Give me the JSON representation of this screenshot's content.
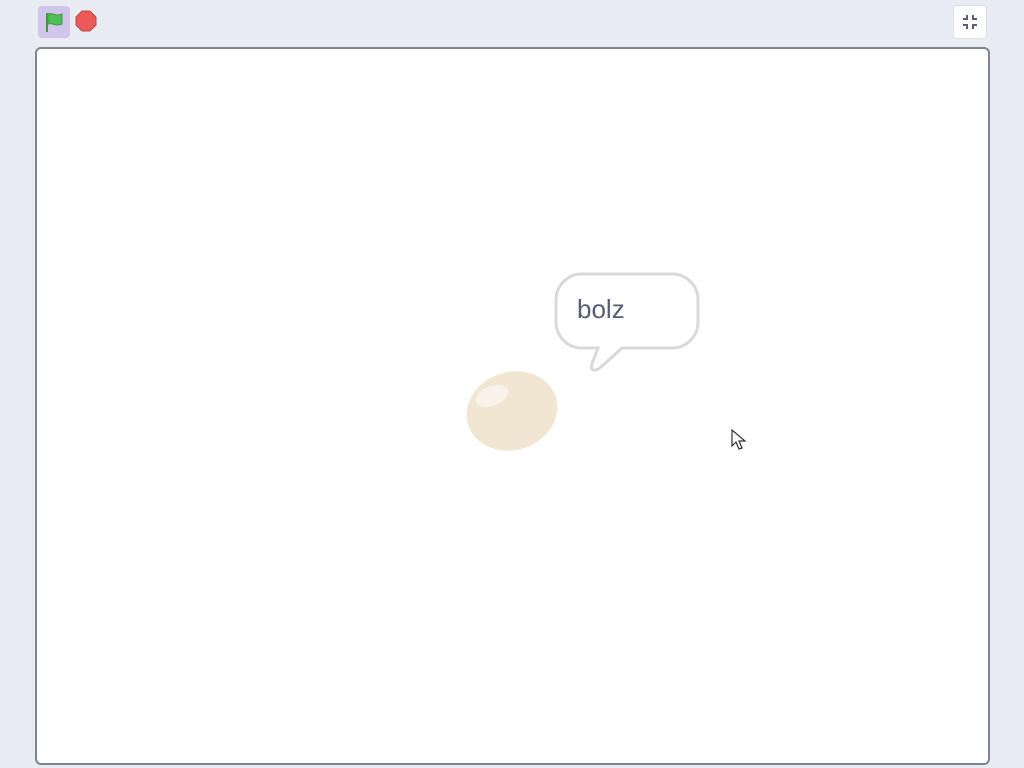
{
  "toolbar": {
    "green_flag": {
      "icon": "green-flag-icon",
      "color": "#4cbf56",
      "active_bg": "#d2c5ec"
    },
    "stop": {
      "icon": "stop-icon",
      "color": "#ec5959"
    },
    "fullscreen": {
      "icon": "exit-fullscreen-icon"
    }
  },
  "stage": {
    "sprite": {
      "icon": "egg-sprite",
      "color": "#f1e6d1"
    },
    "speech_bubble": {
      "text": "bolz"
    }
  }
}
